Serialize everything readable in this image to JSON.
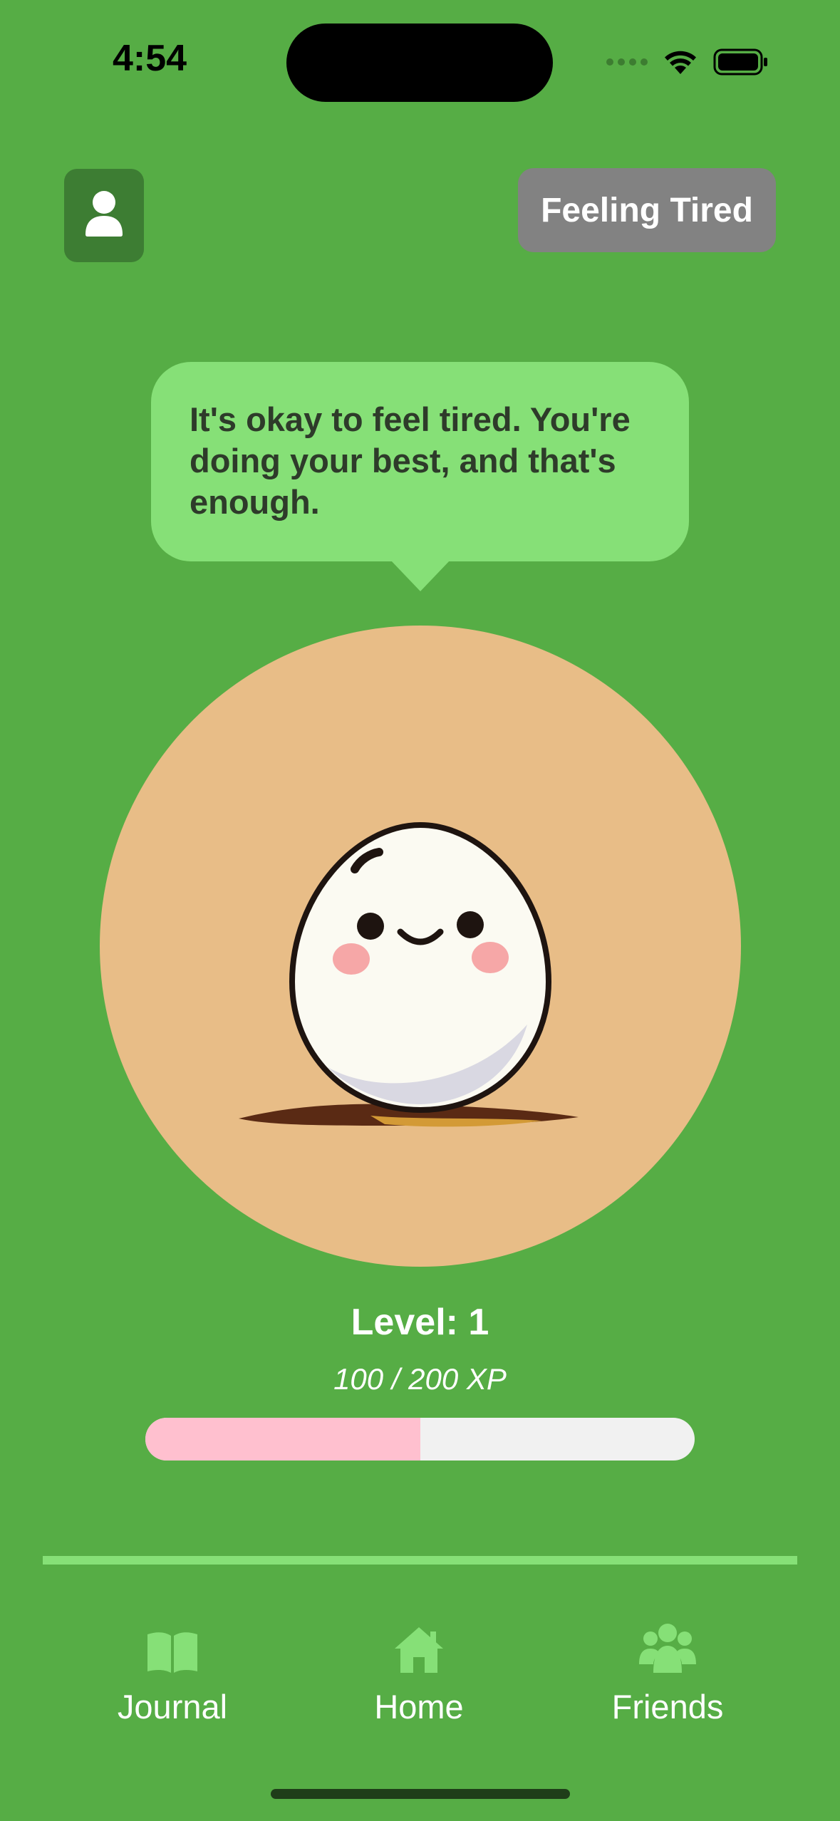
{
  "status_bar": {
    "time": "4:54"
  },
  "header": {
    "mood_label": "Feeling Tired"
  },
  "bubble": {
    "message": "It's okay to feel tired. You're doing your best, and that's enough."
  },
  "pet": {
    "name_icon": "egg-character"
  },
  "level": {
    "label": "Level: 1",
    "xp_text": "100 / 200 XP",
    "progress_fraction": 0.5
  },
  "tabs": [
    {
      "label": "Journal",
      "icon": "book-icon"
    },
    {
      "label": "Home",
      "icon": "house-icon"
    },
    {
      "label": "Friends",
      "icon": "people-icon"
    }
  ],
  "colors": {
    "background": "#56ad45",
    "accent": "#86e077",
    "progress_fill": "#ffc0cf",
    "mood_button": "#828282",
    "pet_background": "#e8bd87"
  }
}
